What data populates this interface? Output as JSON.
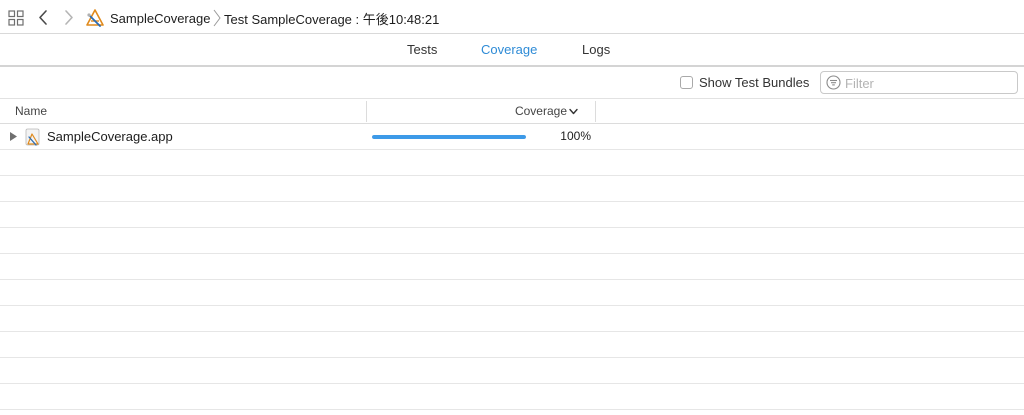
{
  "breadcrumb": {
    "project": "SampleCoverage",
    "run": "Test SampleCoverage : 午後10:48:21"
  },
  "tabs": [
    {
      "label": "Tests",
      "active": false
    },
    {
      "label": "Coverage",
      "active": true
    },
    {
      "label": "Logs",
      "active": false
    }
  ],
  "filterbar": {
    "show_test_bundles_label": "Show Test Bundles",
    "show_test_bundles_checked": false,
    "filter_placeholder": "Filter"
  },
  "table": {
    "columns": {
      "name": "Name",
      "coverage": "Coverage"
    },
    "rows": [
      {
        "name": "SampleCoverage.app",
        "coverage_text": "100%",
        "coverage_fraction": 1.0,
        "icon": "app-bundle-icon"
      }
    ]
  },
  "colors": {
    "accent": "#2e8bd6",
    "bar_fill": "#3d9ae8",
    "bar_track": "#e4e4e4"
  }
}
